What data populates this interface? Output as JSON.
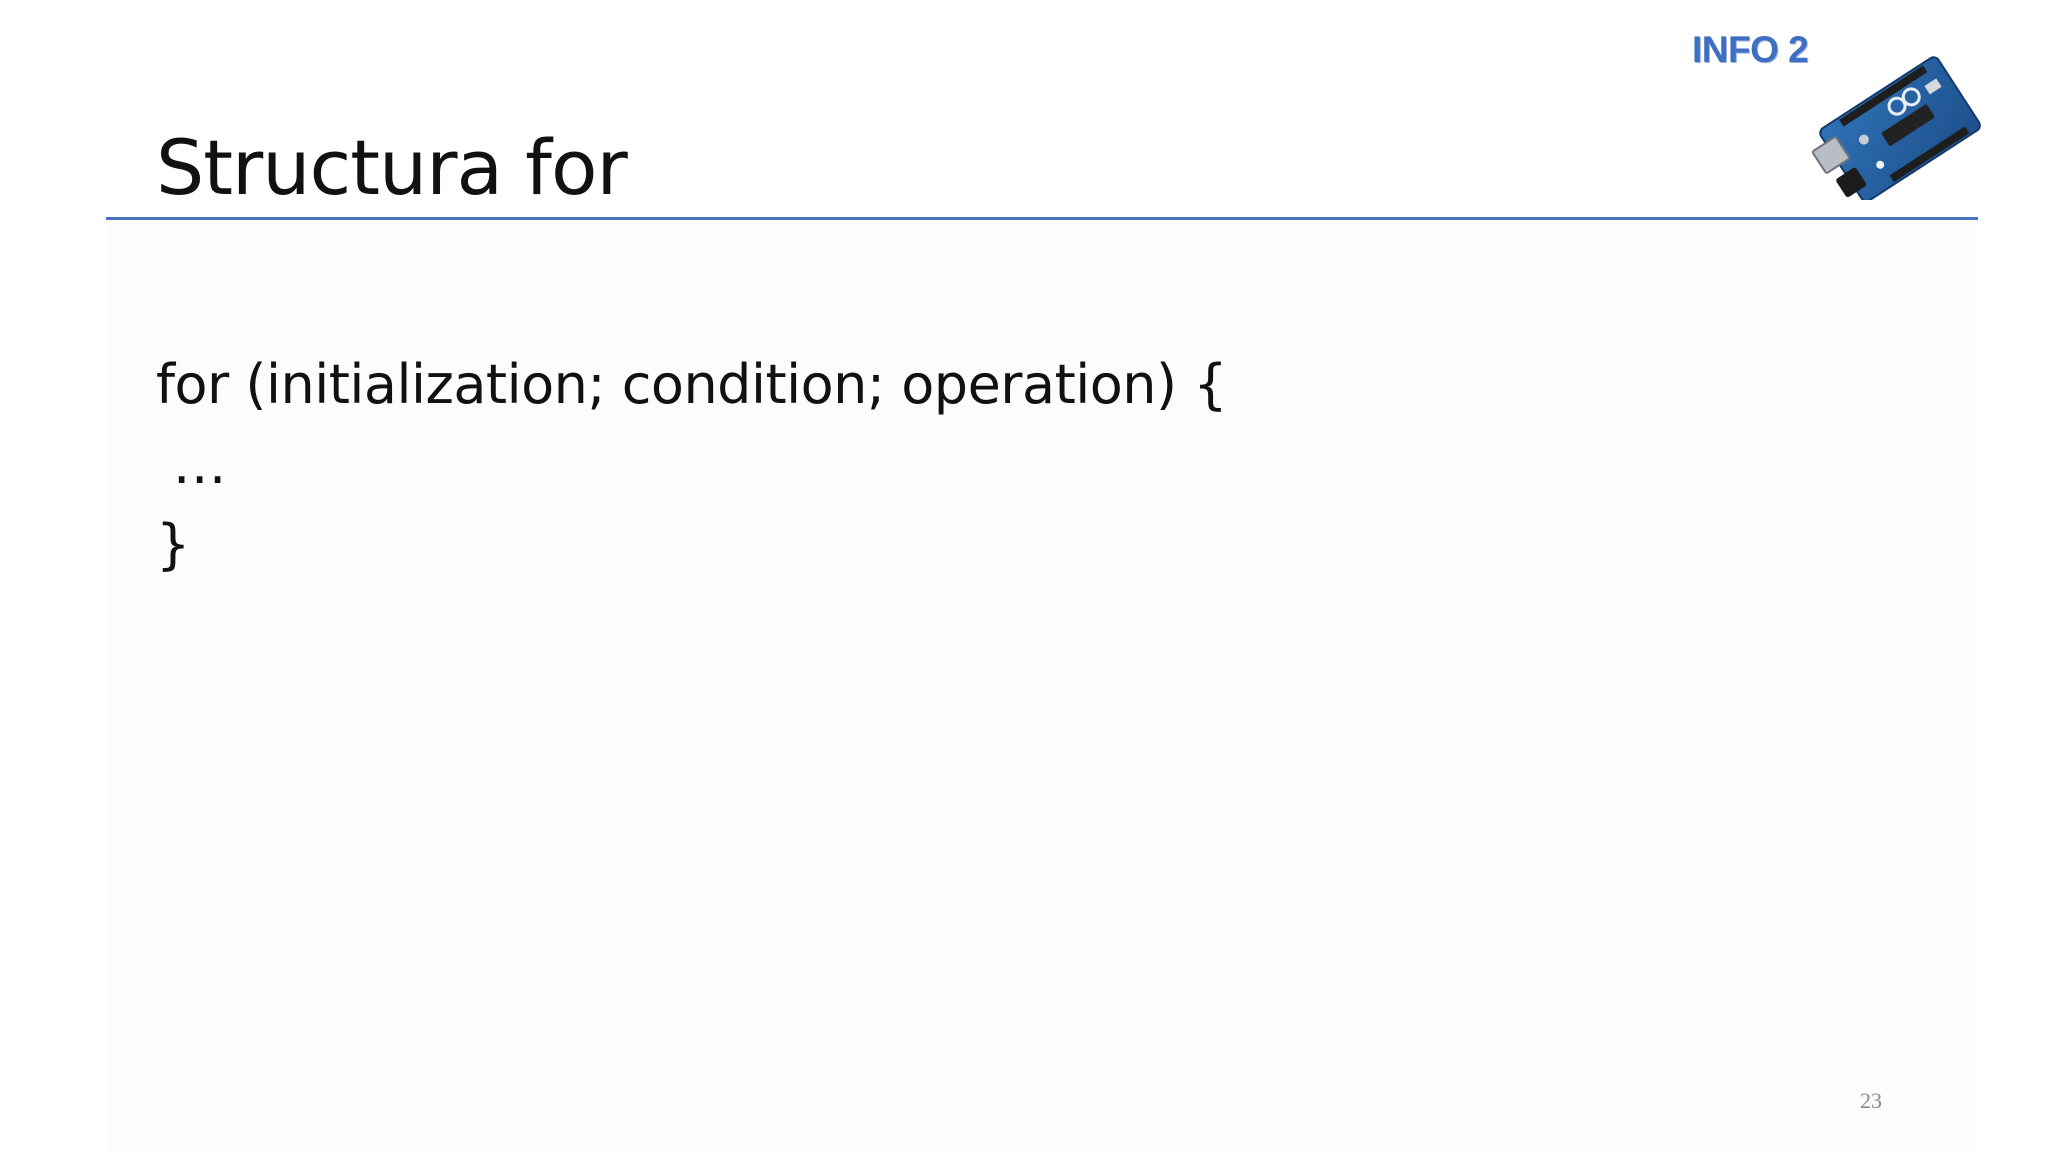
{
  "slide": {
    "title": "Structura for",
    "brand_label": "INFO 2",
    "board_image": "arduino-board-icon",
    "code_lines": [
      "for (initialization; condition; operation) {",
      " …",
      "}"
    ],
    "page_number": "23"
  },
  "colors": {
    "accent_rule": "#4a72be",
    "brand_text": "#3f6fc2",
    "text": "#111111",
    "page_number": "#8a8a8a"
  }
}
